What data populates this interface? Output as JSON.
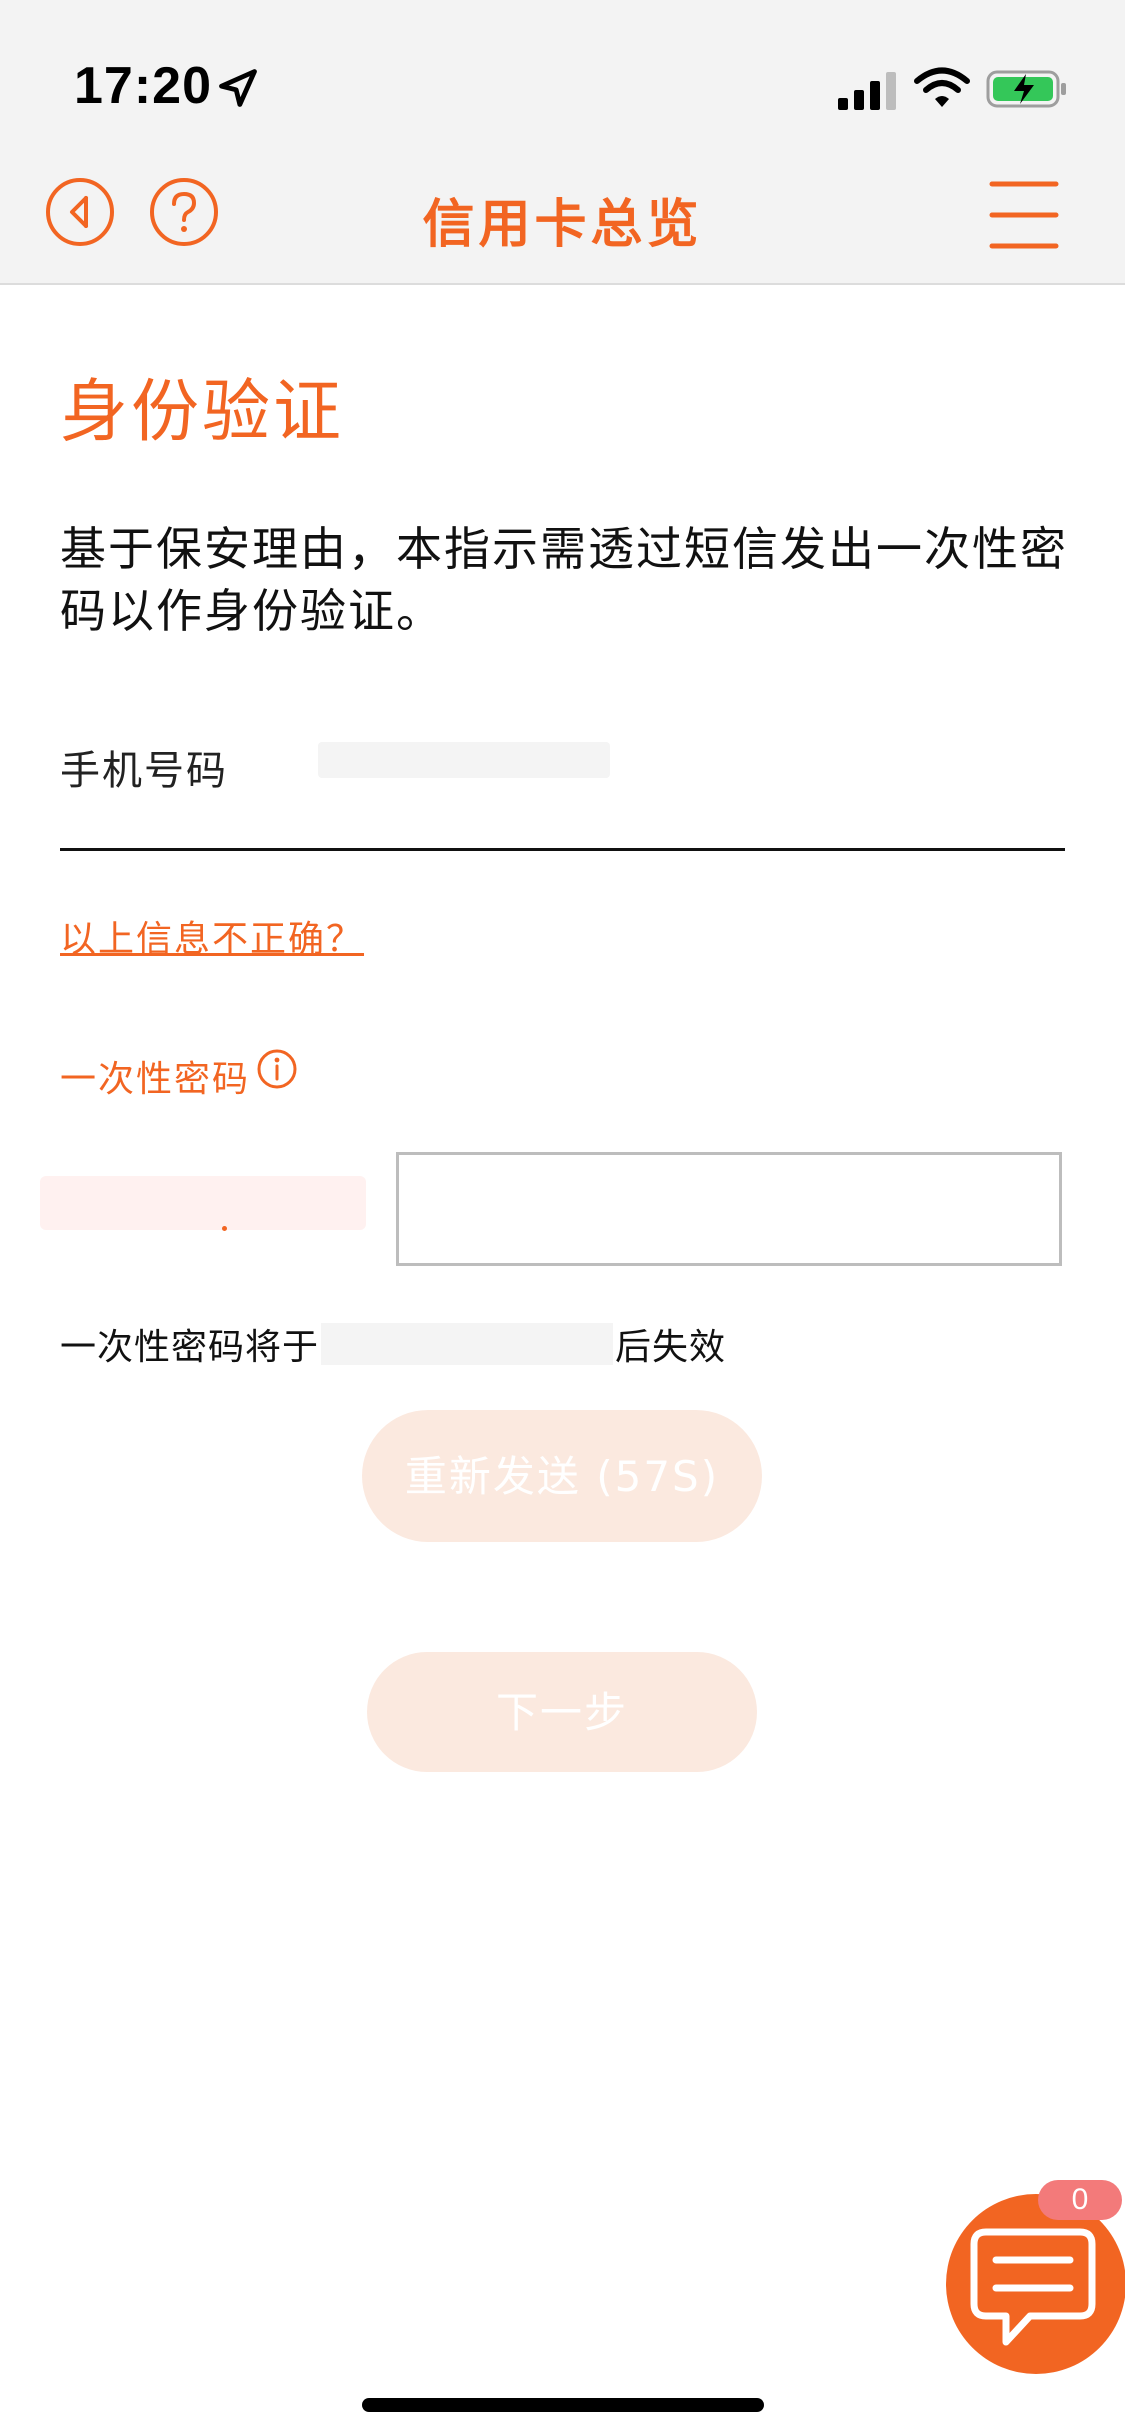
{
  "status_bar": {
    "time": "17:20"
  },
  "nav": {
    "title": "信用卡总览",
    "icons": [
      "back-icon",
      "help-icon",
      "menu-icon"
    ],
    "accent_color": "#f26522"
  },
  "page": {
    "heading": "身份验证",
    "intro": "基于保安理由，本指示需透过短信发出一次性密码以作身份验证。",
    "phone_label": "手机号码",
    "incorrect_link": "以上信息不正确？",
    "otp_label": "一次性密码",
    "otp_placeholder": "",
    "expiry_prefix": "一次性密码将于",
    "expiry_suffix": "后失效",
    "resend_button": "重新发送 (57S)",
    "next_button": "下一步"
  },
  "chat": {
    "badge_count": "0",
    "icon": "chat-icon"
  }
}
